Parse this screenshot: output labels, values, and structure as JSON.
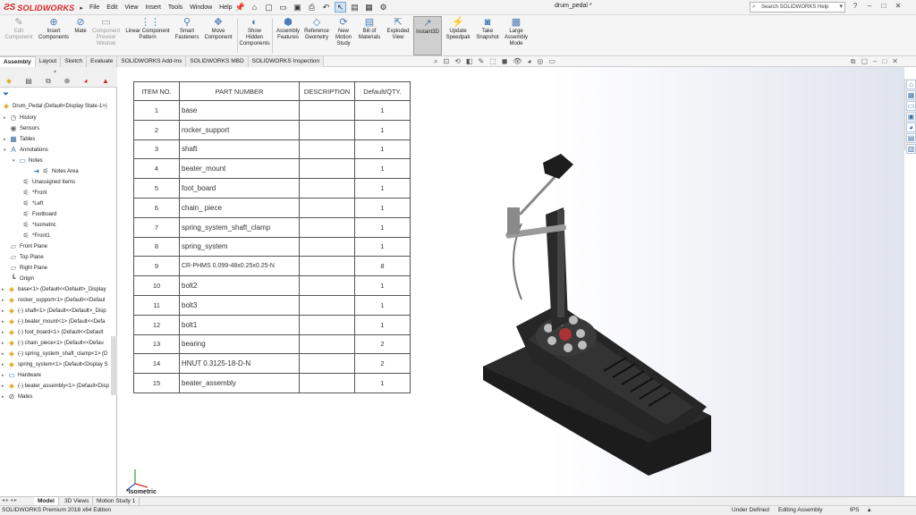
{
  "titlebar": {
    "logo_text": "SOLIDWORKS",
    "menu": [
      "File",
      "Edit",
      "View",
      "Insert",
      "Tools",
      "Window",
      "Help"
    ],
    "doc_title": "drum_pedal *",
    "search_placeholder": "Search SOLIDWORKS Help"
  },
  "commands": [
    {
      "label": "Edit Component",
      "disabled": true
    },
    {
      "label": "Insert Components"
    },
    {
      "label": "Mate"
    },
    {
      "label": "Component Preview Window",
      "disabled": true
    },
    {
      "label": "Linear Component Pattern"
    },
    {
      "label": "Smart Fasteners"
    },
    {
      "label": "Move Component"
    },
    {
      "label": "Show Hidden Components"
    },
    {
      "label": "Assembly Features"
    },
    {
      "label": "Reference Geometry"
    },
    {
      "label": "New Motion Study"
    },
    {
      "label": "Bill of Materials"
    },
    {
      "label": "Exploded View"
    },
    {
      "label": "Instant3D",
      "active": true
    },
    {
      "label": "Update Speedpak"
    },
    {
      "label": "Take Snapshot"
    },
    {
      "label": "Large Assembly Mode"
    }
  ],
  "cmd_tabs": [
    "Assembly",
    "Layout",
    "Sketch",
    "Evaluate",
    "SOLIDWORKS Add-Ins",
    "SOLIDWORKS MBD",
    "SOLIDWORKS Inspection"
  ],
  "tree": {
    "root": "Drum_Pedal  (Default<Display State-1>)",
    "items": [
      "History",
      "Sensors",
      "Tables",
      "Annotations",
      "Notes",
      "Notes Area",
      "Unassigned Items",
      "*Front",
      "*Left",
      "Footboard",
      "*Isometric",
      "*Front1",
      "Front Plane",
      "Top Plane",
      "Right Plane",
      "Origin",
      "base<1> (Default<<Default>_Display",
      "rocker_support<1> (Default<<Defaul",
      "(-) shaft<1> (Default<<Default>_Disp",
      "(-) beater_mount<1> (Default<<Defa",
      "(-) foot_board<1> (Default<<Default",
      "(-) chain_piece<1> (Default<<Defau",
      "(-) spring_system_shaft_clamp<1> (D",
      "spring_system<1> (Default<Display S",
      "Hardware",
      "(-) beater_assembly<1> (Default<Disp",
      "Mates"
    ]
  },
  "bom": {
    "headers": [
      "ITEM NO.",
      "PART NUMBER",
      "DESCRIPTION",
      "Default/QTY."
    ],
    "rows": [
      [
        "1",
        "base",
        "",
        "1"
      ],
      [
        "2",
        "rocker_support",
        "",
        "1"
      ],
      [
        "3",
        "shaft",
        "",
        "1"
      ],
      [
        "4",
        "beater_mount",
        "",
        "1"
      ],
      [
        "5",
        "foot_board",
        "",
        "1"
      ],
      [
        "6",
        "chain_ piece",
        "",
        "1"
      ],
      [
        "7",
        "spring_system_shaft_clamp",
        "",
        "1"
      ],
      [
        "8",
        "spring_system",
        "",
        "1"
      ],
      [
        "9",
        "CR-PHMS 0.099-48x0.25x0.25-N",
        "",
        "8"
      ],
      [
        "10",
        "bolt2",
        "",
        "1"
      ],
      [
        "11",
        "bolt3",
        "",
        "1"
      ],
      [
        "12",
        "bolt1",
        "",
        "1"
      ],
      [
        "13",
        "bearing",
        "",
        "2"
      ],
      [
        "14",
        "HNUT 0.3125-18-D-N",
        "",
        "2"
      ],
      [
        "15",
        "beater_assembly",
        "",
        "1"
      ]
    ]
  },
  "view_name": "*Isometric",
  "bottom_tabs": [
    "Model",
    "3D Views",
    "Motion Study 1"
  ],
  "status": {
    "edition": "SOLIDWORKS Premium 2018 x64 Edition",
    "state": "Under Defined",
    "mode": "Editing Assembly",
    "units": "IPS"
  }
}
